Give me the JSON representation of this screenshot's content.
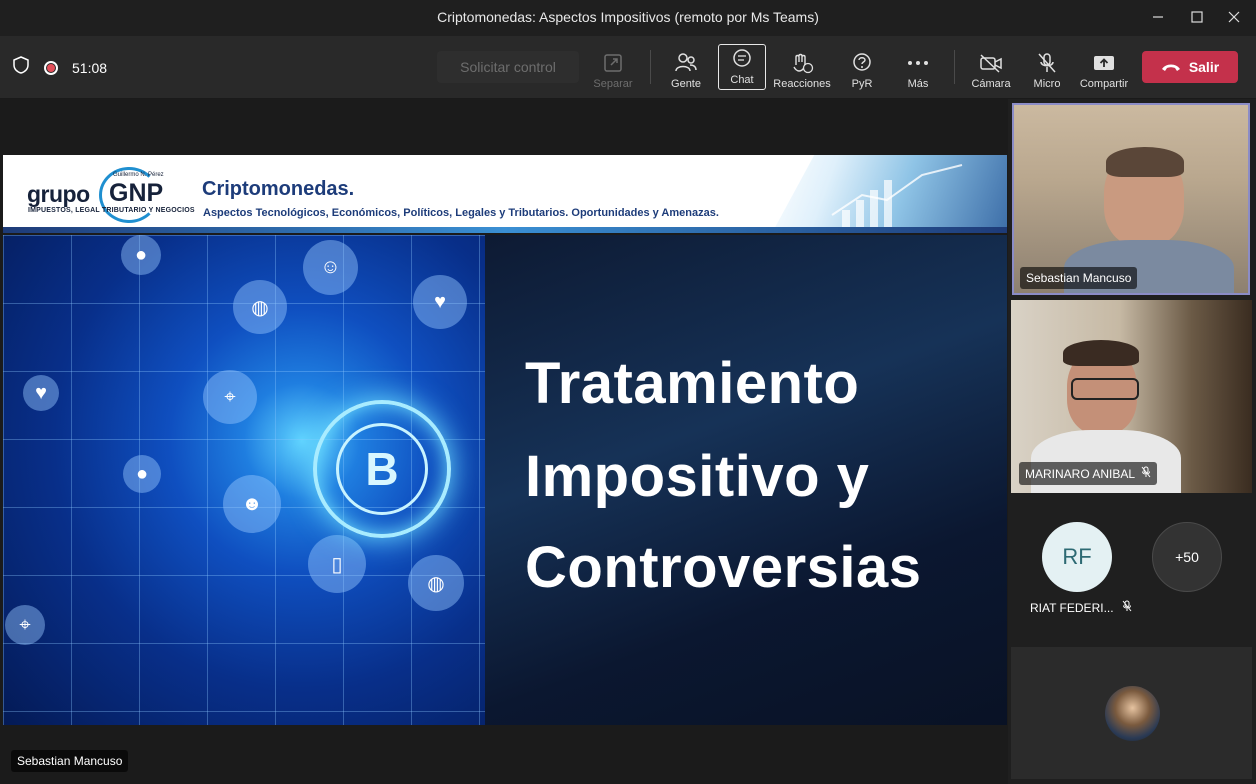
{
  "window": {
    "title": "Criptomonedas: Aspectos Impositivos (remoto por Ms Teams)"
  },
  "toolbar": {
    "timer": "51:08",
    "request_control": "Solicitar control",
    "separate": "Separar",
    "people": "Gente",
    "chat": "Chat",
    "reactions": "Reacciones",
    "qa": "PyR",
    "more": "Más",
    "camera": "Cámara",
    "mic": "Micro",
    "share": "Compartir",
    "leave": "Salir"
  },
  "slide": {
    "logo_grupo": "grupo",
    "logo_gnp": "GNP",
    "logo_small": "Guillermo N. Pérez",
    "logo_sub": "IMPUESTOS, LEGAL TRIBUTARIO Y NEGOCIOS",
    "title": "Criptomonedas.",
    "subtitle": "Aspectos Tecnológicos, Económicos, Políticos, Legales y Tributarios. Oportunidades y Amenazas.",
    "line1": "Tratamiento",
    "line2": "Impositivo y",
    "line3": "Controversias",
    "bitcoin_symbol": "B"
  },
  "stage": {
    "presenter": "Sebastian Mancuso"
  },
  "participants": {
    "tile1_name": "Sebastian Mancuso",
    "tile2_name": "MARINARO ANIBAL",
    "rf_initials": "RF",
    "rf_name": "RIAT FEDERI...",
    "more_count": "+50"
  },
  "colors": {
    "leave_button": "#c4314b",
    "active_speaker_border": "#8b8cc7",
    "recording": "#e3505a"
  }
}
